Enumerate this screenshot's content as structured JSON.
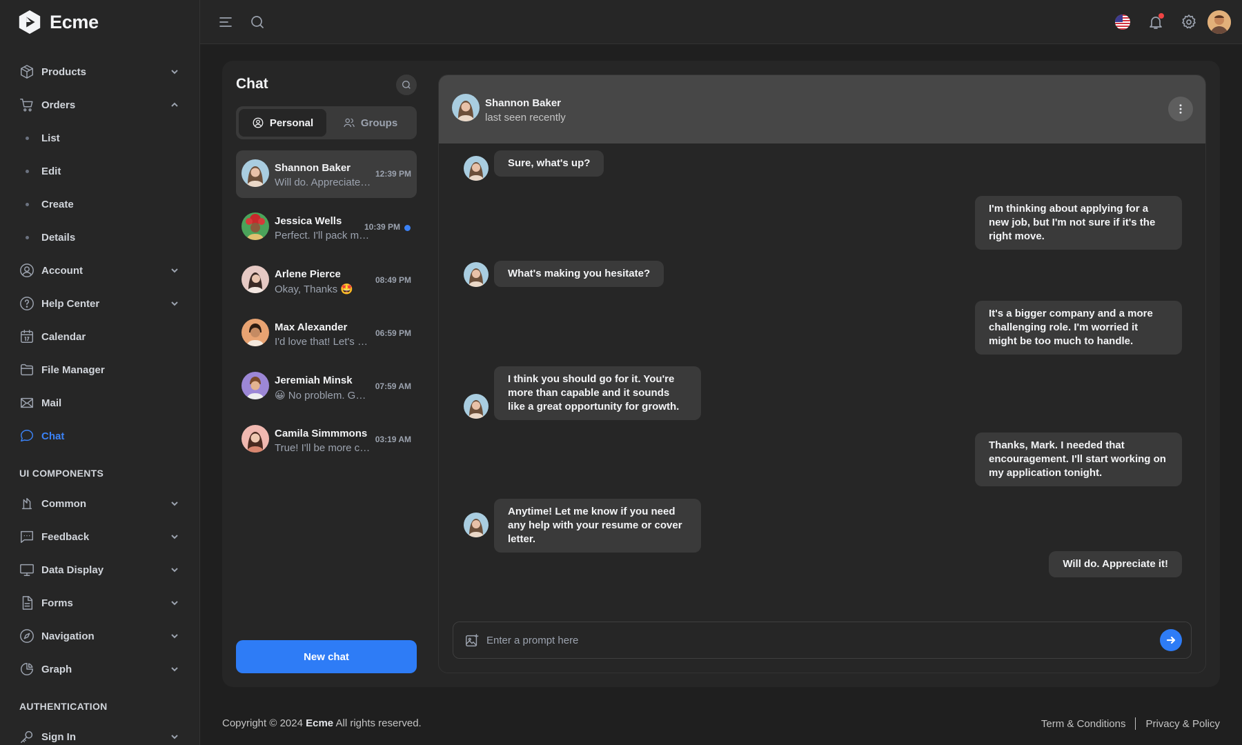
{
  "app": {
    "name": "Ecme"
  },
  "sidebar": {
    "items": [
      {
        "label": "Products",
        "icon": "box-icon",
        "expandable": true,
        "expanded": false
      },
      {
        "label": "Orders",
        "icon": "cart-icon",
        "expandable": true,
        "expanded": true,
        "children": [
          "List",
          "Edit",
          "Create",
          "Details"
        ]
      },
      {
        "label": "Account",
        "icon": "user-circle-icon",
        "expandable": true,
        "expanded": false
      },
      {
        "label": "Help Center",
        "icon": "help-icon",
        "expandable": true,
        "expanded": false
      },
      {
        "label": "Calendar",
        "icon": "calendar-icon",
        "expandable": false
      },
      {
        "label": "File Manager",
        "icon": "folder-icon",
        "expandable": false
      },
      {
        "label": "Mail",
        "icon": "mail-icon",
        "expandable": false
      },
      {
        "label": "Chat",
        "icon": "chat-icon",
        "expandable": false,
        "active": true
      }
    ],
    "section_ui": "UI COMPONENTS",
    "ui_items": [
      {
        "label": "Common",
        "icon": "common-icon"
      },
      {
        "label": "Feedback",
        "icon": "feedback-icon"
      },
      {
        "label": "Data Display",
        "icon": "monitor-icon"
      },
      {
        "label": "Forms",
        "icon": "form-icon"
      },
      {
        "label": "Navigation",
        "icon": "compass-icon"
      },
      {
        "label": "Graph",
        "icon": "pie-icon"
      }
    ],
    "section_auth": "AUTHENTICATION",
    "auth_items": [
      {
        "label": "Sign In",
        "icon": "key-icon"
      }
    ]
  },
  "chat_list": {
    "title": "Chat",
    "tabs": [
      {
        "label": "Personal",
        "active": true
      },
      {
        "label": "Groups",
        "active": false
      }
    ],
    "conversations": [
      {
        "name": "Shannon Baker",
        "preview": "Will do. Appreciate it!",
        "time": "12:39 PM",
        "active": true,
        "avatar_color": "#b98b73"
      },
      {
        "name": "Jessica Wells",
        "preview": "Perfect. I'll pack my bags",
        "time": "10:39 PM",
        "unread": true,
        "avatar_color": "#8b3a2f"
      },
      {
        "name": "Arlene Pierce",
        "preview": "Okay, Thanks 🤩",
        "time": "08:49 PM",
        "avatar_color": "#c9a39a"
      },
      {
        "name": "Max Alexander",
        "preview": "I'd love that! Let's do it",
        "time": "06:59 PM",
        "avatar_color": "#a0714f"
      },
      {
        "name": "Jeremiah Minsk",
        "preview": "😀 No problem. Good luck",
        "time": "07:59 AM",
        "avatar_color": "#9b7fc4"
      },
      {
        "name": "Camila Simmmons",
        "preview": "True! I'll be more careful",
        "time": "03:19 AM",
        "avatar_color": "#c47d6d"
      }
    ],
    "new_chat_label": "New chat"
  },
  "conversation": {
    "contact_name": "Shannon Baker",
    "contact_status": "last seen recently",
    "messages": [
      {
        "from": "them",
        "text": "Sure, what's up?"
      },
      {
        "from": "me",
        "text": "I'm thinking about applying for a new job, but I'm not sure if it's the right move."
      },
      {
        "from": "them",
        "text": "What's making you hesitate?"
      },
      {
        "from": "me",
        "text": "It's a bigger company and a more challenging role. I'm worried it might be too much to handle."
      },
      {
        "from": "them",
        "text": "I think you should go for it. You're more than capable and it sounds like a great opportunity for growth."
      },
      {
        "from": "me",
        "text": "Thanks, Mark. I needed that encouragement. I'll start working on my application tonight."
      },
      {
        "from": "them",
        "text": "Anytime! Let me know if you need any help with your resume or cover letter."
      },
      {
        "from": "me",
        "text": "Will do. Appreciate it!"
      }
    ],
    "input_placeholder": "Enter a prompt here"
  },
  "footer": {
    "copyright_prefix": "Copyright © 2024",
    "brand": "Ecme",
    "copyright_suffix": "All rights reserved.",
    "links": [
      "Term & Conditions",
      "Privacy & Policy"
    ]
  },
  "colors": {
    "accent": "#2e7cf6",
    "background": "#1f1f1f",
    "panel": "#262626",
    "bubble": "#3a3a3a",
    "notification": "#ef4444"
  }
}
